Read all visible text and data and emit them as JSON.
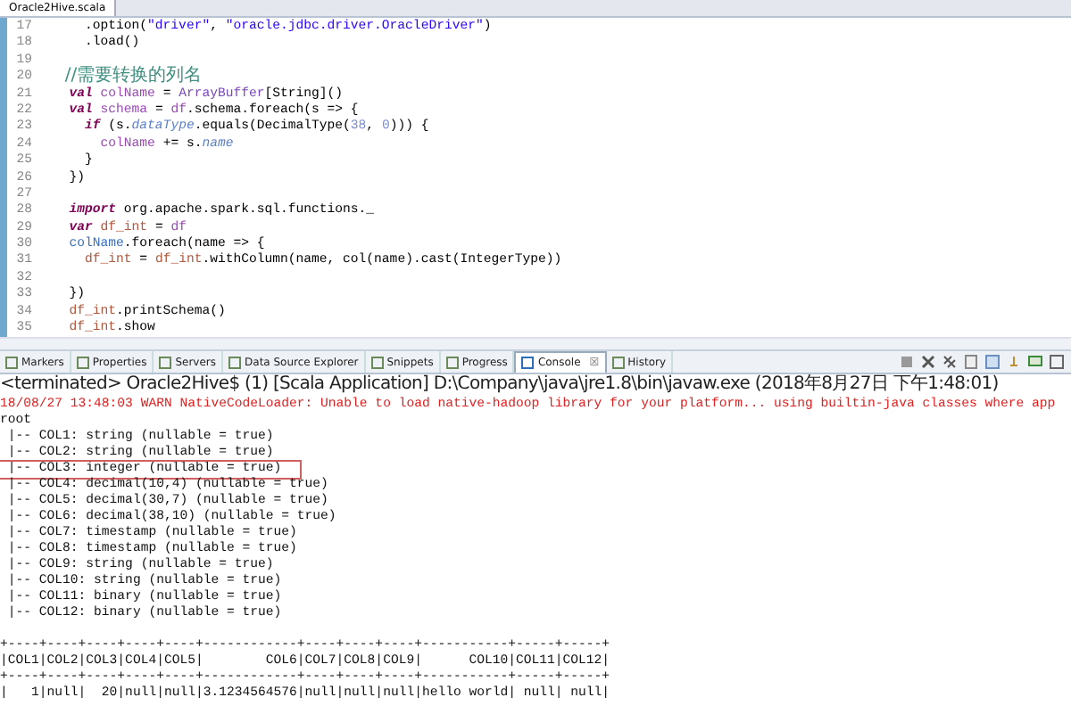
{
  "editor": {
    "tab": "Oracle2Hive.scala",
    "lines": [
      {
        "num": "17",
        "segs": [
          {
            "t": "    .option(",
            "kind": "plain"
          },
          {
            "t": "\"driver\"",
            "kind": "str"
          },
          {
            "t": ", ",
            "kind": "plain"
          },
          {
            "t": "\"oracle.jdbc.driver.OracleDriver\"",
            "kind": "str"
          },
          {
            "t": ")",
            "kind": "plain"
          }
        ]
      },
      {
        "num": "18",
        "segs": [
          {
            "t": "    .load()",
            "kind": "plain"
          }
        ]
      },
      {
        "num": "19"
      },
      {
        "num": "20",
        "segs": [
          {
            "t": "  //需要转换的列名",
            "kind": "comment"
          }
        ]
      },
      {
        "num": "21",
        "segs": [
          {
            "t": "  val",
            "kind": "kw"
          },
          {
            "t": " colName",
            "kind": "val"
          },
          {
            "t": " = ",
            "kind": "plain"
          },
          {
            "t": "ArrayBuffer",
            "kind": "type"
          },
          {
            "t": "[String]()",
            "kind": "plain"
          }
        ]
      },
      {
        "num": "22",
        "segs": [
          {
            "t": "  val",
            "kind": "kw"
          },
          {
            "t": " schema",
            "kind": "val"
          },
          {
            "t": " = ",
            "kind": "plain"
          },
          {
            "t": "df",
            "kind": "val"
          },
          {
            "t": ".schema.foreach(s => {",
            "kind": "plain"
          }
        ]
      },
      {
        "num": "23",
        "segs": [
          {
            "t": "    if",
            "kind": "kw"
          },
          {
            "t": " (s.",
            "kind": "plain"
          },
          {
            "t": "dataType",
            "kind": "field"
          },
          {
            "t": ".equals(DecimalType(",
            "kind": "plain"
          },
          {
            "t": "38",
            "kind": "num"
          },
          {
            "t": ", ",
            "kind": "plain"
          },
          {
            "t": "0",
            "kind": "num"
          },
          {
            "t": "))) {",
            "kind": "plain"
          }
        ]
      },
      {
        "num": "24",
        "segs": [
          {
            "t": "      colName",
            "kind": "val"
          },
          {
            "t": " += s.",
            "kind": "plain"
          },
          {
            "t": "name",
            "kind": "field"
          }
        ]
      },
      {
        "num": "25",
        "segs": [
          {
            "t": "    }",
            "kind": "plain"
          }
        ]
      },
      {
        "num": "26",
        "segs": [
          {
            "t": "  })",
            "kind": "plain"
          }
        ]
      },
      {
        "num": "27"
      },
      {
        "num": "28",
        "segs": [
          {
            "t": "  import",
            "kind": "kw"
          },
          {
            "t": " org.apache.spark.sql.functions._",
            "kind": "plain"
          }
        ]
      },
      {
        "num": "29",
        "segs": [
          {
            "t": "  var",
            "kind": "kw"
          },
          {
            "t": " df_int",
            "kind": "var"
          },
          {
            "t": " = ",
            "kind": "plain"
          },
          {
            "t": "df",
            "kind": "val"
          }
        ]
      },
      {
        "num": "30",
        "segs": [
          {
            "t": "  colName",
            "kind": "ref"
          },
          {
            "t": ".foreach(name => {",
            "kind": "plain"
          }
        ]
      },
      {
        "num": "31",
        "segs": [
          {
            "t": "    df_int",
            "kind": "var"
          },
          {
            "t": " = ",
            "kind": "plain"
          },
          {
            "t": "df_int",
            "kind": "var"
          },
          {
            "t": ".withColumn(name, col(name).cast(IntegerType))",
            "kind": "plain"
          }
        ]
      },
      {
        "num": "32"
      },
      {
        "num": "33",
        "segs": [
          {
            "t": "  })",
            "kind": "plain"
          }
        ]
      },
      {
        "num": "34",
        "segs": [
          {
            "t": "  df_int",
            "kind": "var"
          },
          {
            "t": ".printSchema()",
            "kind": "plain"
          }
        ]
      },
      {
        "num": "35",
        "segs": [
          {
            "t": "  df_int",
            "kind": "var"
          },
          {
            "t": ".show",
            "kind": "plain"
          }
        ]
      }
    ]
  },
  "console": {
    "tabs": [
      {
        "label": "Markers",
        "selected": false
      },
      {
        "label": "Properties",
        "selected": false
      },
      {
        "label": "Servers",
        "selected": false
      },
      {
        "label": "Data Source Explorer",
        "selected": false
      },
      {
        "label": "Snippets",
        "selected": false
      },
      {
        "label": "Progress",
        "selected": false
      },
      {
        "label": "Console",
        "selected": true,
        "close": "☒"
      },
      {
        "label": "History",
        "selected": false
      }
    ],
    "status": "<terminated> Oracle2Hive$ (1) [Scala Application] D:\\Company\\java\\jre1.8\\bin\\javaw.exe (2018年8月27日 下午1:48:01)",
    "lines": [
      {
        "text": "18/08/27 13:48:03 WARN NativeCodeLoader: Unable to load native-hadoop library for your platform... using builtin-java classes where app",
        "kind": "warn",
        "boxed": false
      },
      {
        "text": "root",
        "kind": "out",
        "boxed": false
      },
      {
        "text": " |-- COL1: string (nullable = true)",
        "kind": "out",
        "boxed": false
      },
      {
        "text": " |-- COL2: string (nullable = true)",
        "kind": "out",
        "boxed": false
      },
      {
        "text": " |-- COL3: integer (nullable = true)",
        "kind": "out",
        "boxed": true
      },
      {
        "text": " |-- COL4: decimal(10,4) (nullable = true)",
        "kind": "out",
        "boxed": false
      },
      {
        "text": " |-- COL5: decimal(30,7) (nullable = true)",
        "kind": "out",
        "boxed": false
      },
      {
        "text": " |-- COL6: decimal(38,10) (nullable = true)",
        "kind": "out",
        "boxed": false
      },
      {
        "text": " |-- COL7: timestamp (nullable = true)",
        "kind": "out",
        "boxed": false
      },
      {
        "text": " |-- COL8: timestamp (nullable = true)",
        "kind": "out",
        "boxed": false
      },
      {
        "text": " |-- COL9: string (nullable = true)",
        "kind": "out",
        "boxed": false
      },
      {
        "text": " |-- COL10: string (nullable = true)",
        "kind": "out",
        "boxed": false
      },
      {
        "text": " |-- COL11: binary (nullable = true)",
        "kind": "out",
        "boxed": false
      },
      {
        "text": " |-- COL12: binary (nullable = true)",
        "kind": "out",
        "boxed": false
      },
      {
        "kind": "blank"
      },
      {
        "text": "+----+----+----+----+----+------------+----+----+----+-----------+-----+-----+",
        "kind": "out",
        "boxed": false
      },
      {
        "text": "|COL1|COL2|COL3|COL4|COL5|        COL6|COL7|COL8|COL9|      COL10|COL11|COL12|",
        "kind": "out",
        "boxed": false
      },
      {
        "text": "+----+----+----+----+----+------------+----+----+----+-----------+-----+-----+",
        "kind": "out",
        "boxed": false
      },
      {
        "text": "|   1|null|  20|null|null|3.1234564576|null|null|null|hello world| null| null|",
        "kind": "out",
        "boxed": false
      }
    ]
  }
}
